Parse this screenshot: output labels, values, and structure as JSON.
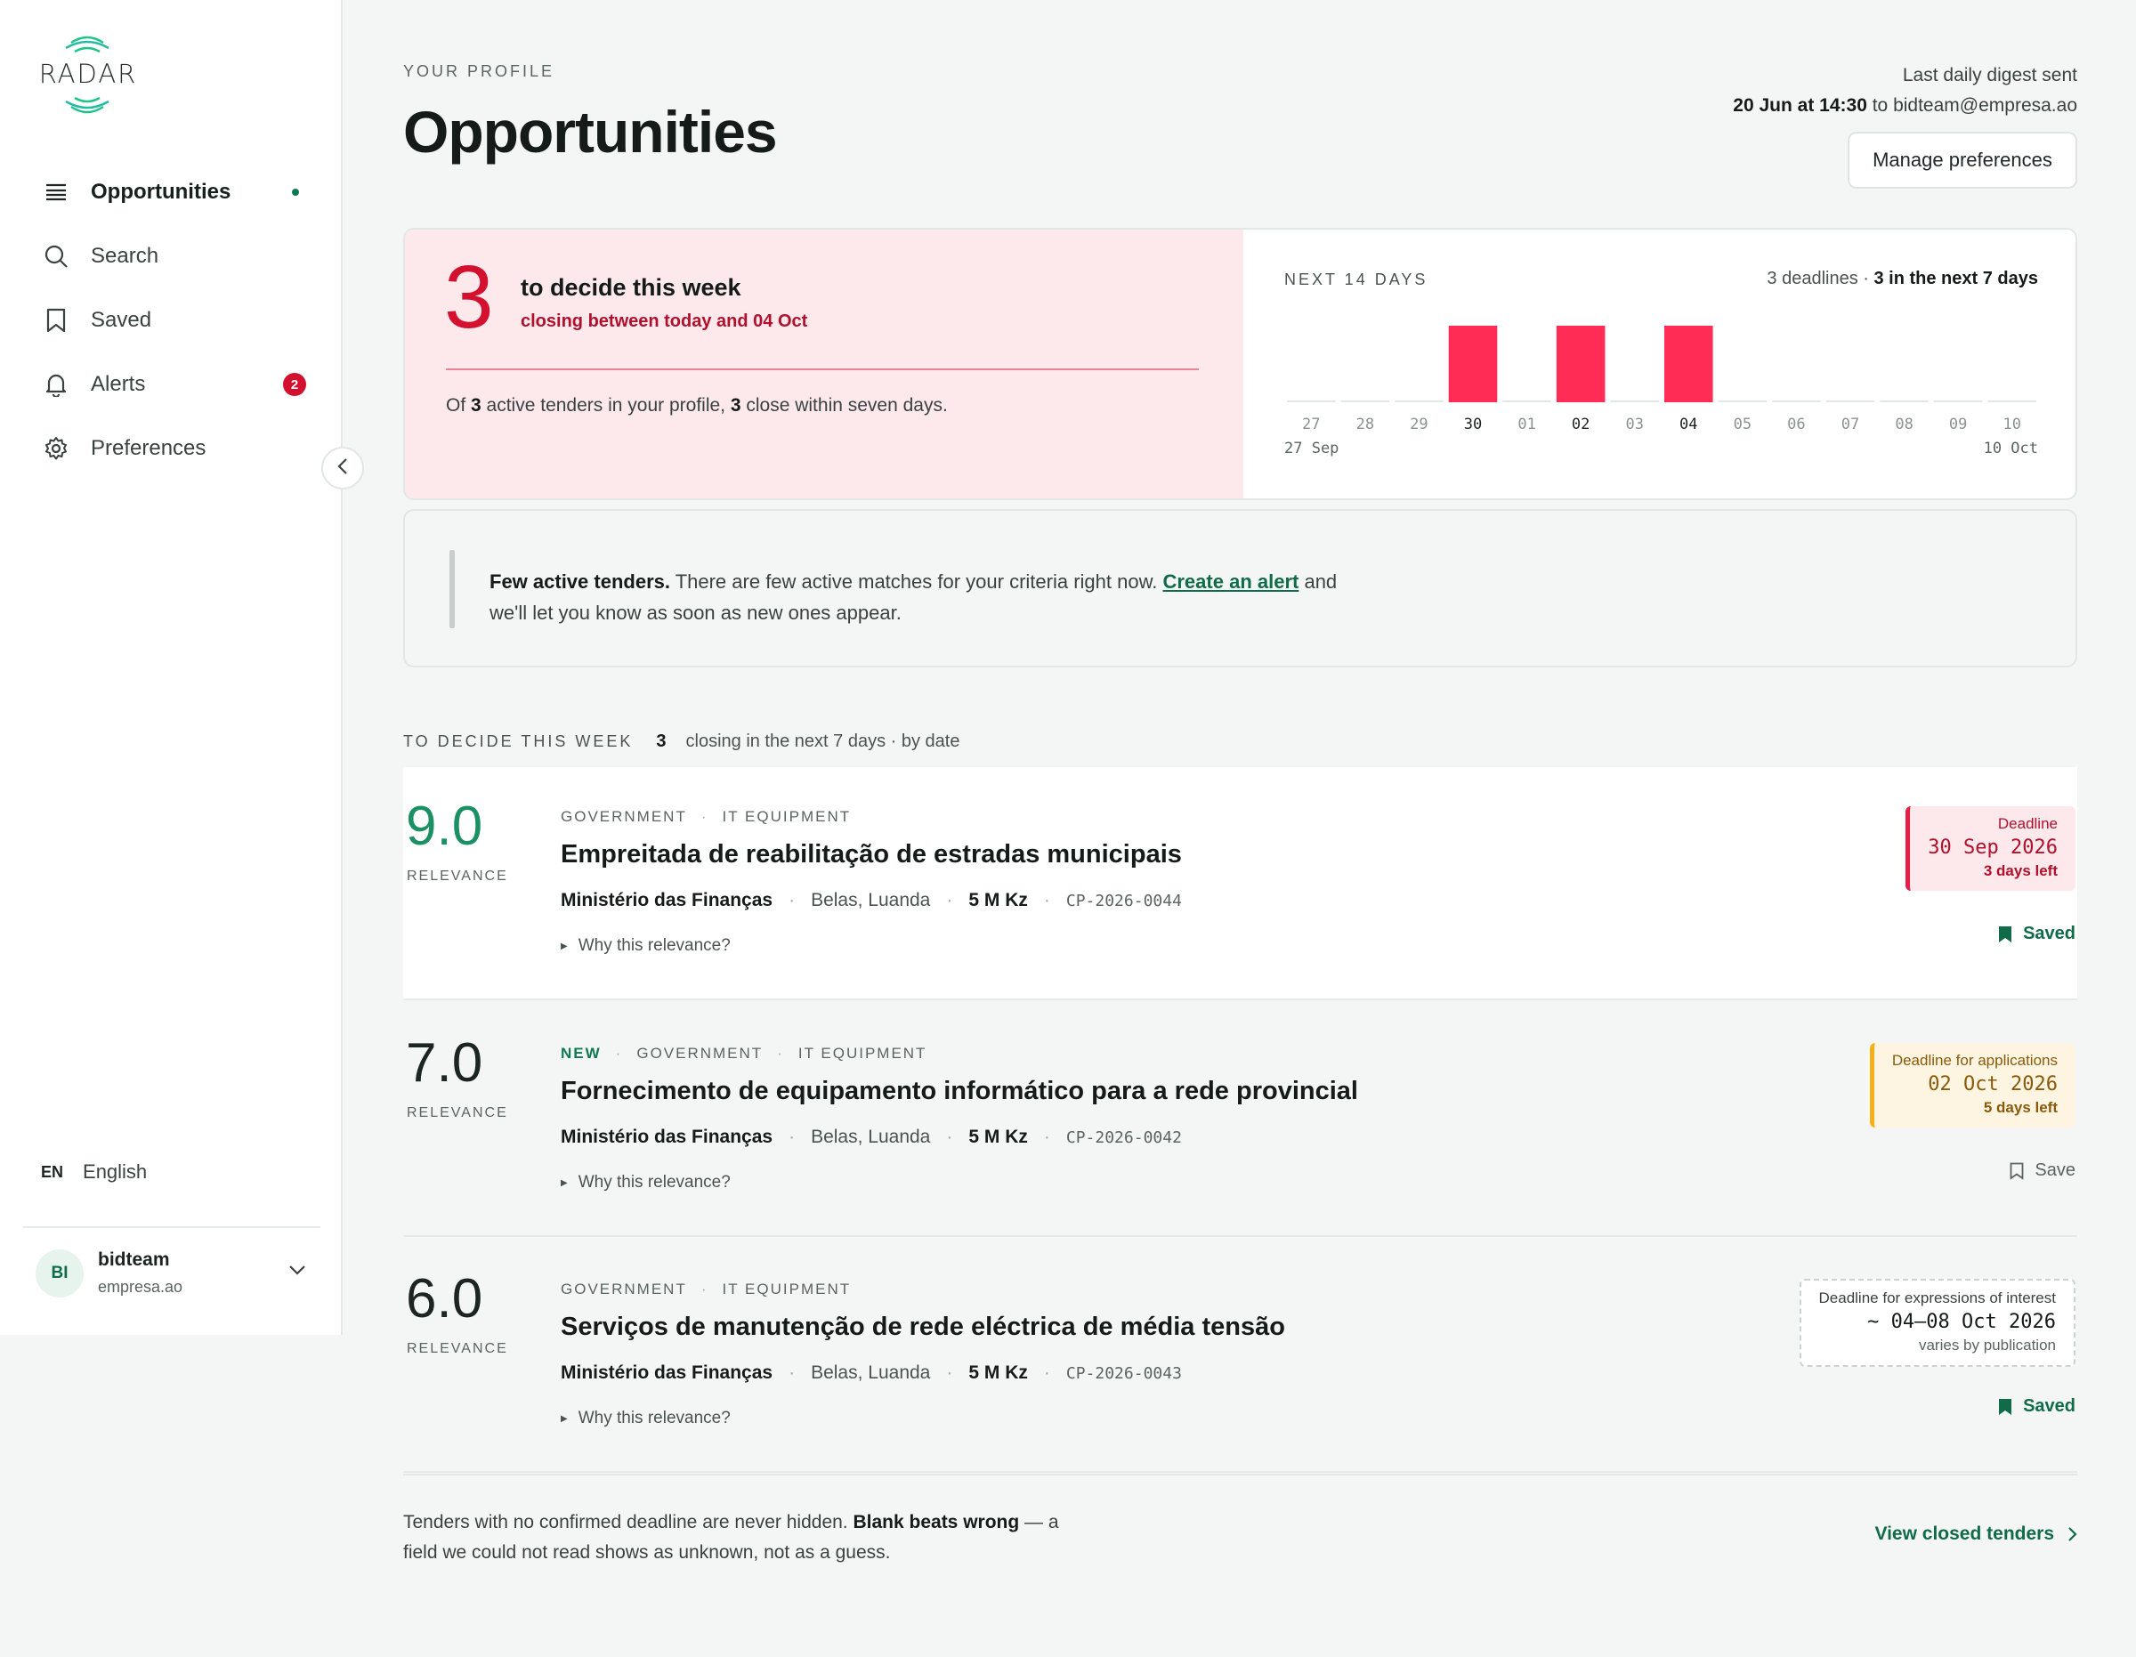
{
  "app": {
    "logo_text": "RADAR"
  },
  "sidebar": {
    "items": [
      {
        "label": "Opportunities",
        "icon": "list-icon",
        "active": true
      },
      {
        "label": "Search",
        "icon": "search-icon"
      },
      {
        "label": "Saved",
        "icon": "bookmark-icon"
      },
      {
        "label": "Alerts",
        "icon": "bell-icon",
        "badge": "2"
      },
      {
        "label": "Preferences",
        "icon": "gear-icon"
      }
    ],
    "language": {
      "code": "EN",
      "label": "English"
    },
    "user": {
      "initials": "BI",
      "name": "bidteam",
      "org": "empresa.ao"
    }
  },
  "header": {
    "eyebrow": "YOUR PROFILE",
    "title": "Opportunities",
    "digest_label": "Last daily digest sent",
    "digest_time": "20 Jun at 14:30",
    "digest_to": " to bidteam@empresa.ao",
    "manage_label": "Manage preferences"
  },
  "summary": {
    "count": "3",
    "title": "to decide this week",
    "subtitle": "closing between today and 04 Oct",
    "note_pre": "Of ",
    "note_active": "3",
    "note_mid": " active tenders in your profile, ",
    "note_close": "3",
    "note_post": " close within seven days.",
    "next_label": "NEXT 14 DAYS",
    "deadlines_text": "3 deadlines · ",
    "deadlines_bold": "3 in the next 7 days",
    "range_start": "27 Sep",
    "range_end": "10 Oct"
  },
  "chart_data": {
    "type": "bar",
    "categories": [
      "27",
      "28",
      "29",
      "30",
      "01",
      "02",
      "03",
      "04",
      "05",
      "06",
      "07",
      "08",
      "09",
      "10"
    ],
    "values": [
      0,
      0,
      0,
      1,
      0,
      1,
      0,
      1,
      0,
      0,
      0,
      0,
      0,
      0
    ],
    "title": "NEXT 14 DAYS",
    "bar_color": "#ff2d55",
    "grid": false
  },
  "notice": {
    "bold": "Few active tenders.",
    "text": " There are few active matches for your criteria right now. ",
    "link": "Create an alert",
    "text2": " and we'll let you know as soon as new ones appear."
  },
  "list": {
    "label": "TO DECIDE THIS WEEK",
    "count": "3",
    "desc": "closing in the next 7 days · by date"
  },
  "tenders": [
    {
      "score": "9.0",
      "score_label": "RELEVANCE",
      "new": "",
      "tag1": "GOVERNMENT",
      "tag2": "IT EQUIPMENT",
      "title": "Empreitada de reabilitação de estradas municipais",
      "buyer": "Ministério das Finanças",
      "location": "Belas, Luanda",
      "value": "5 M Kz",
      "ref": "CP-2026-0044",
      "why": "Why this relevance?",
      "deadline_label": "Deadline",
      "deadline_date": "30 Sep 2026",
      "deadline_sub": "3 days left",
      "save_label": "Saved"
    },
    {
      "score": "7.0",
      "score_label": "RELEVANCE",
      "new": "NEW",
      "tag1": "GOVERNMENT",
      "tag2": "IT EQUIPMENT",
      "title": "Fornecimento de equipamento informático para a rede provincial",
      "buyer": "Ministério das Finanças",
      "location": "Belas, Luanda",
      "value": "5 M Kz",
      "ref": "CP-2026-0042",
      "why": "Why this relevance?",
      "deadline_label": "Deadline for applications",
      "deadline_date": "02 Oct 2026",
      "deadline_sub": "5 days left",
      "save_label": "Save"
    },
    {
      "score": "6.0",
      "score_label": "RELEVANCE",
      "new": "",
      "tag1": "GOVERNMENT",
      "tag2": "IT EQUIPMENT",
      "title": "Serviços de manutenção de rede eléctrica de média tensão",
      "buyer": "Ministério das Finanças",
      "location": "Belas, Luanda",
      "value": "5 M Kz",
      "ref": "CP-2026-0043",
      "why": "Why this relevance?",
      "deadline_label": "Deadline for expressions of interest",
      "deadline_date": "~ 04–08 Oct 2026",
      "deadline_sub": "varies by publication",
      "save_label": "Saved"
    }
  ],
  "footer": {
    "note_pre": "Tenders with no confirmed deadline are never hidden. ",
    "note_bold": "Blank beats wrong",
    "note_post": " — a field we could not read shows as unknown, not as a guess.",
    "link": "View closed tenders"
  },
  "colors": {
    "accent": "#0f6b48",
    "alert": "#d3112f",
    "bar": "#ff2d55",
    "amber": "#f4b117"
  }
}
